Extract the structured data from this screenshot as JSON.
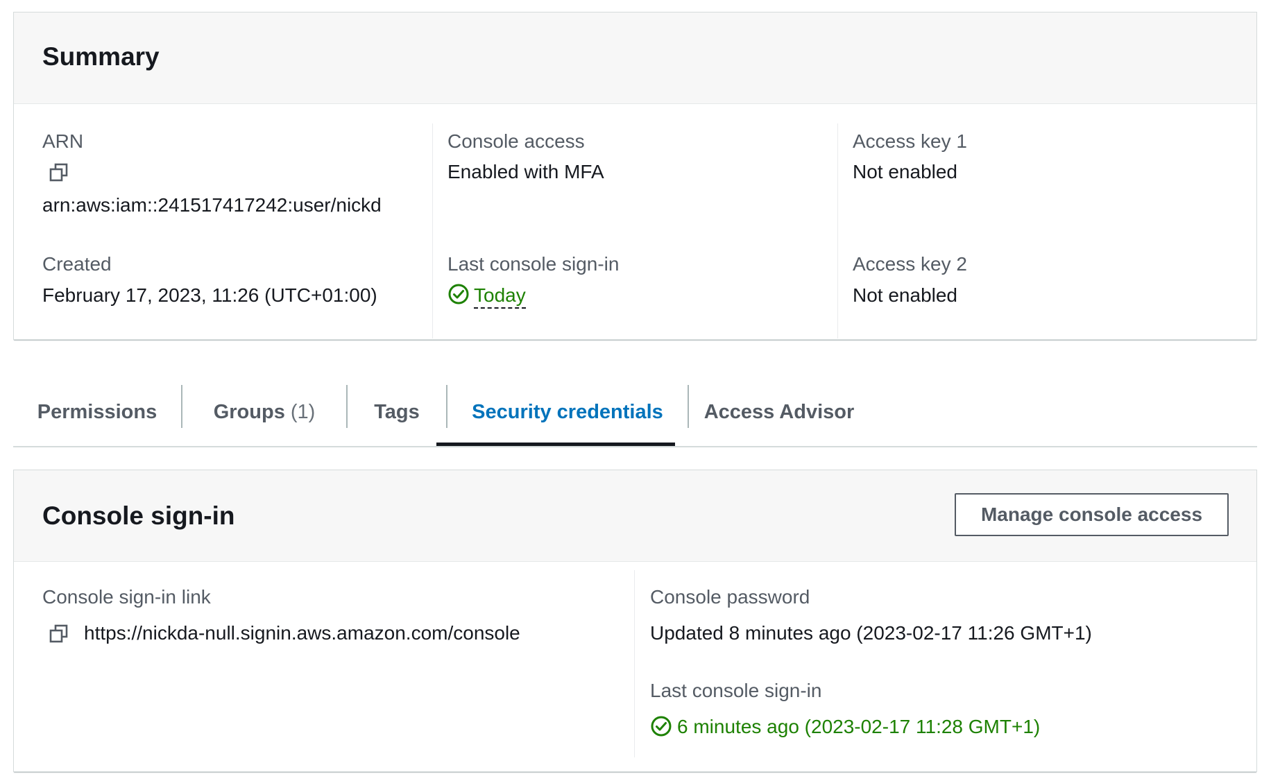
{
  "summary": {
    "title": "Summary",
    "arn_label": "ARN",
    "arn_value": "arn:aws:iam::241517417242:user/nickd",
    "created_label": "Created",
    "created_value": "February 17, 2023, 11:26 (UTC+01:00)",
    "console_access_label": "Console access",
    "console_access_value": "Enabled with MFA",
    "last_signin_label": "Last console sign-in",
    "last_signin_value": "Today",
    "access_key1_label": "Access key 1",
    "access_key1_value": "Not enabled",
    "access_key2_label": "Access key 2",
    "access_key2_value": "Not enabled"
  },
  "tabs": [
    {
      "label": "Permissions",
      "count": ""
    },
    {
      "label": "Groups",
      "count": "(1)"
    },
    {
      "label": "Tags",
      "count": ""
    },
    {
      "label": "Security credentials",
      "count": "",
      "active": true
    },
    {
      "label": "Access Advisor",
      "count": ""
    }
  ],
  "console_signin": {
    "title": "Console sign-in",
    "manage_button": "Manage console access",
    "link_label": "Console sign-in link",
    "link_value": "https://nickda-null.signin.aws.amazon.com/console",
    "password_label": "Console password",
    "password_value": "Updated 8 minutes ago (2023-02-17 11:26 GMT+1)",
    "last_signin_label": "Last console sign-in",
    "last_signin_value": "6 minutes ago (2023-02-17 11:28 GMT+1)"
  },
  "icons": {
    "copy": "copy-icon",
    "success": "check-circle-icon"
  },
  "colors": {
    "accent": "#0073bb",
    "success": "#1d8102",
    "header_bg": "#f7f7f7"
  }
}
